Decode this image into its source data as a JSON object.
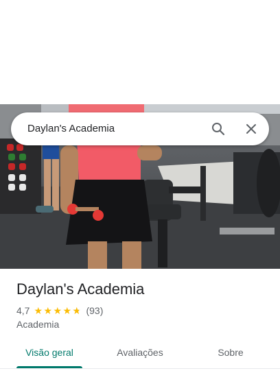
{
  "search": {
    "query": "Daylan's Academia",
    "search_icon": "search-icon",
    "close_icon": "close-icon"
  },
  "photo": {
    "icon": "place-photo"
  },
  "place": {
    "name": "Daylan's Academia",
    "rating": "4,7",
    "rating_value": 4.7,
    "stars_max": 5,
    "reviews": "(93)",
    "category": "Academia"
  },
  "tabs": [
    {
      "label": "Visão geral",
      "active": true
    },
    {
      "label": "Avaliações",
      "active": false
    },
    {
      "label": "Sobre",
      "active": false
    }
  ],
  "colors": {
    "accent": "#00796b",
    "star": "#fbbc04",
    "text_primary": "#202124",
    "text_secondary": "#5f6368"
  }
}
